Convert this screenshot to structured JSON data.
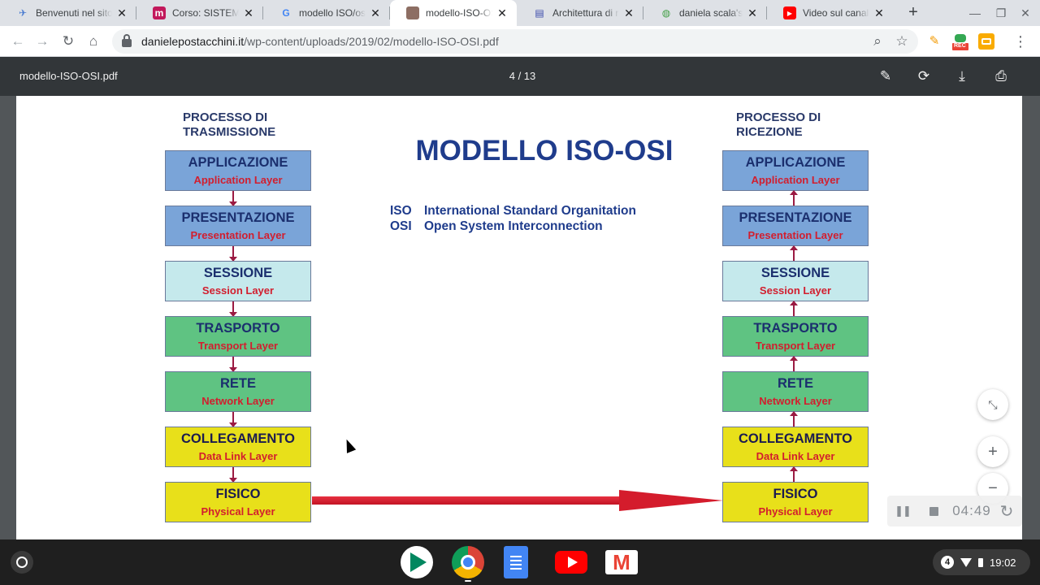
{
  "browser": {
    "tabs": [
      {
        "title": "Benvenuti nel sito",
        "favicon": "blue-bird-icon",
        "favicon_color": "#4a7bd0",
        "active": false
      },
      {
        "title": "Corso: SISTEMI E",
        "favicon": "m-logo-icon",
        "favicon_color": "#c2185b",
        "active": false
      },
      {
        "title": "modello ISO/osi n",
        "favicon": "google-g-icon",
        "favicon_color": "#4285f4",
        "active": false
      },
      {
        "title": "modello-ISO-OSI.p",
        "favicon": "photo-thumbnail-icon",
        "favicon_color": "#8d6e63",
        "active": true
      },
      {
        "title": "Architettura di ret",
        "favicon": "network-doc-icon",
        "favicon_color": "#3949ab",
        "active": false
      },
      {
        "title": "daniela scala's Lit",
        "favicon": "green-globe-icon",
        "favicon_color": "#43a047",
        "active": false
      },
      {
        "title": "Video sul canale",
        "favicon": "youtube-icon",
        "favicon_color": "#ff0000",
        "active": false
      }
    ],
    "new_tab_glyph": "+",
    "url_domain": "danielepostacchini.it",
    "url_path": "/wp-content/uploads/2019/02/modello-ISO-OSI.pdf",
    "extensions": [
      {
        "name": "pencil-extension-icon",
        "color": "#f29900"
      },
      {
        "name": "rec-extension-icon",
        "label": "REC",
        "color": "#34a853"
      },
      {
        "name": "orange-extension-icon",
        "color": "#f9ab00"
      }
    ]
  },
  "pdf_viewer": {
    "document_title": "modello-ISO-OSI.pdf",
    "page_indicator": "4 / 13"
  },
  "slide": {
    "title": "MODELLO ISO-OSI",
    "left_process_line1": "PROCESSO DI",
    "left_process_line2": "TRASMISSIONE",
    "right_process_line1": "PROCESSO DI",
    "right_process_line2": "RICEZIONE",
    "definitions": [
      {
        "abbr": "ISO",
        "text": "International Standard Organitation"
      },
      {
        "abbr": "OSI",
        "text": "Open System Interconnection"
      }
    ],
    "layers": [
      {
        "name": "APPLICAZIONE",
        "subtitle": "Application Layer",
        "color": "#7aa4d8"
      },
      {
        "name": "PRESENTAZIONE",
        "subtitle": "Presentation Layer",
        "color": "#7aa4d8"
      },
      {
        "name": "SESSIONE",
        "subtitle": "Session Layer",
        "color": "#c5e9ec"
      },
      {
        "name": "TRASPORTO",
        "subtitle": "Transport Layer",
        "color": "#5fc382"
      },
      {
        "name": "RETE",
        "subtitle": "Network Layer",
        "color": "#5fc382"
      },
      {
        "name": "COLLEGAMENTO",
        "subtitle": "Data Link Layer",
        "color": "#e8e01a"
      },
      {
        "name": "FISICO",
        "subtitle": "Physical Layer",
        "color": "#e8e01a"
      }
    ]
  },
  "recorder": {
    "elapsed_time": "04:49"
  },
  "shelf": {
    "apps": [
      "play-store-icon",
      "chrome-icon",
      "docs-icon",
      "youtube-icon",
      "gmail-icon"
    ],
    "notification_count": "4",
    "clock": "19:02"
  },
  "colors": {
    "slide_title": "#1f3c8c",
    "layer_subtitle": "#d21e2e",
    "connector": "#9b1a42",
    "physical_arrow": "#d41c2c"
  }
}
